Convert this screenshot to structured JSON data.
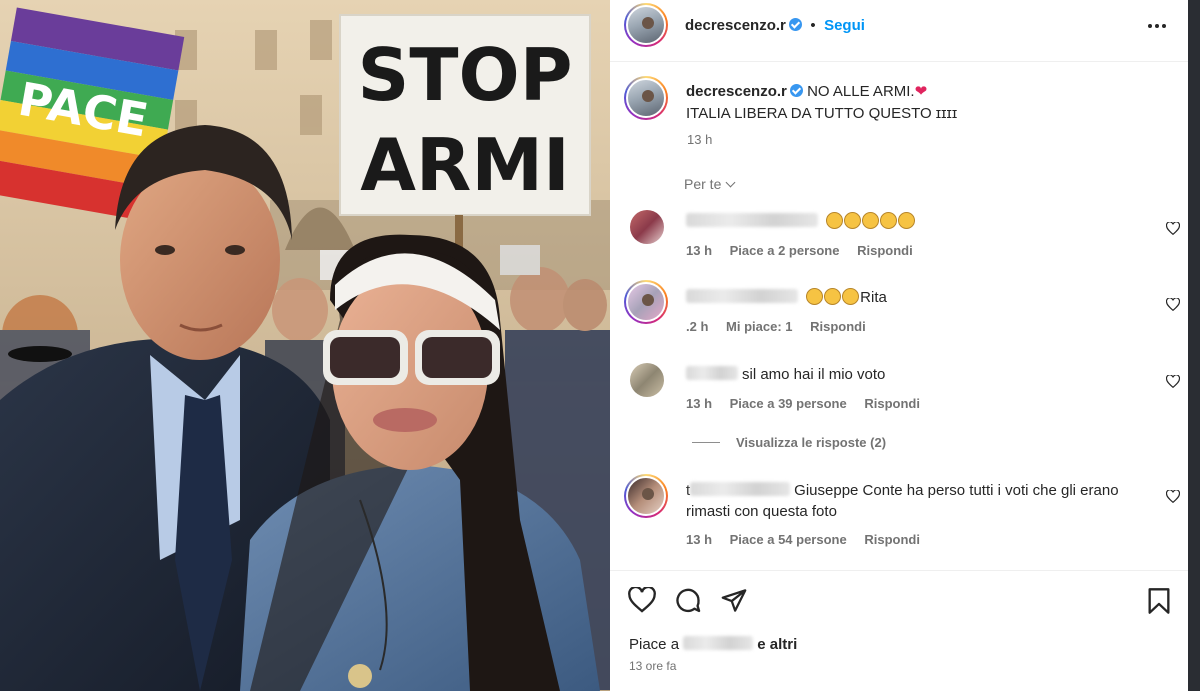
{
  "post": {
    "username": "decrescenzo.r",
    "separator": "•",
    "follow_label": "Segui",
    "more_icon": "more-horizontal-icon"
  },
  "photo": {
    "sign_line1": "STOP",
    "sign_line2": "ARMI",
    "flag_text": "PACE"
  },
  "caption": {
    "username": "decrescenzo.r",
    "line1": "NO ALLE ARMI.",
    "line1_emoji": "❤",
    "line2": "ITALIA LIBERA DA TUTTO QUESTO ɪɪɪɪ",
    "time": "13 h"
  },
  "filter": {
    "label": "Per te"
  },
  "comments": [
    {
      "text": "",
      "emoji": [
        "clap",
        "clap",
        "clap",
        "clap",
        "clap"
      ],
      "time": "13 h",
      "likes": "Piace a 2 persone",
      "reply": "Rispondi"
    },
    {
      "text": "Rita",
      "emoji": [
        "clap",
        "clap",
        "clap"
      ],
      "time": ".2 h",
      "likes": "Mi piace: 1",
      "reply": "Rispondi"
    },
    {
      "text": "sil amo hai il mio voto",
      "emoji": [],
      "time": "13 h",
      "likes": "Piace a 39 persone",
      "reply": "Rispondi",
      "view_replies": "Visualizza le risposte (2)"
    },
    {
      "prefix": "t",
      "text": "Giuseppe Conte ha perso tutti i voti che gli erano rimasti con questa foto",
      "emoji": [],
      "time": "13 h",
      "likes": "Piace a 54 persone",
      "reply": "Rispondi"
    }
  ],
  "footer": {
    "likes_prefix": "Piace a",
    "likes_suffix": "e altri",
    "time": "13 ore fa"
  },
  "colors": {
    "link": "#0095f6",
    "muted": "#737373",
    "text": "#262626",
    "verified": "#3897f0"
  }
}
